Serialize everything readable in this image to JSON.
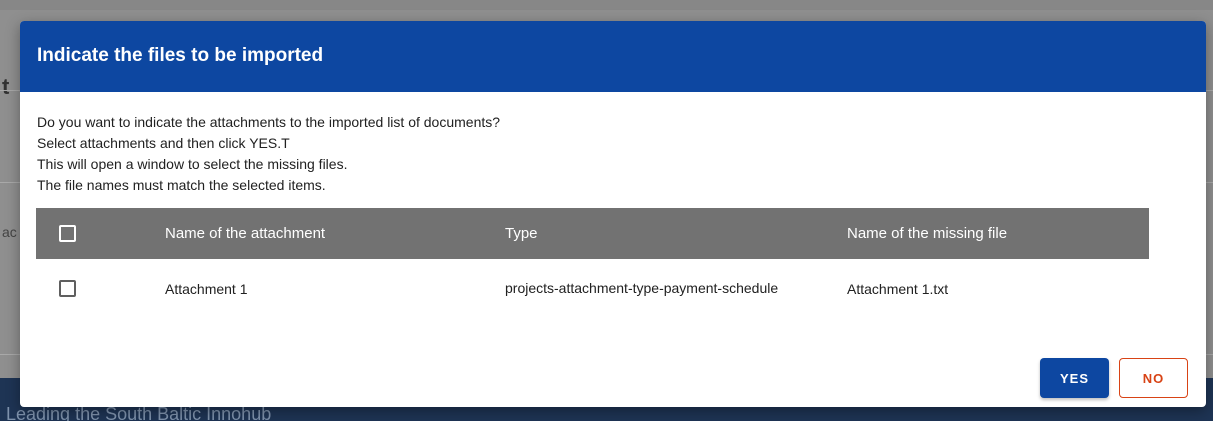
{
  "background": {
    "heading_fragment": "t",
    "text_fragment": "ac",
    "footer_text": "Leading the South Baltic Innohub"
  },
  "dialog": {
    "title": "Indicate the files to be imported",
    "message_lines": [
      "Do you want to indicate the attachments to the imported list of documents?",
      "Select attachments and then click YES.T",
      "This will open a window to select the missing files.",
      "The file names must match the selected items."
    ],
    "table": {
      "columns": [
        "Name of the attachment",
        "Type",
        "Name of the missing file"
      ],
      "rows": [
        {
          "name": "Attachment 1",
          "type": "projects-attachment-type-payment-schedule",
          "missing_file": "Attachment 1.txt"
        }
      ]
    },
    "buttons": {
      "yes": "YES",
      "no": "NO"
    }
  },
  "colors": {
    "header_blue": "#0d47a1",
    "table_header_gray": "#727272",
    "no_button_accent": "#d84315"
  }
}
